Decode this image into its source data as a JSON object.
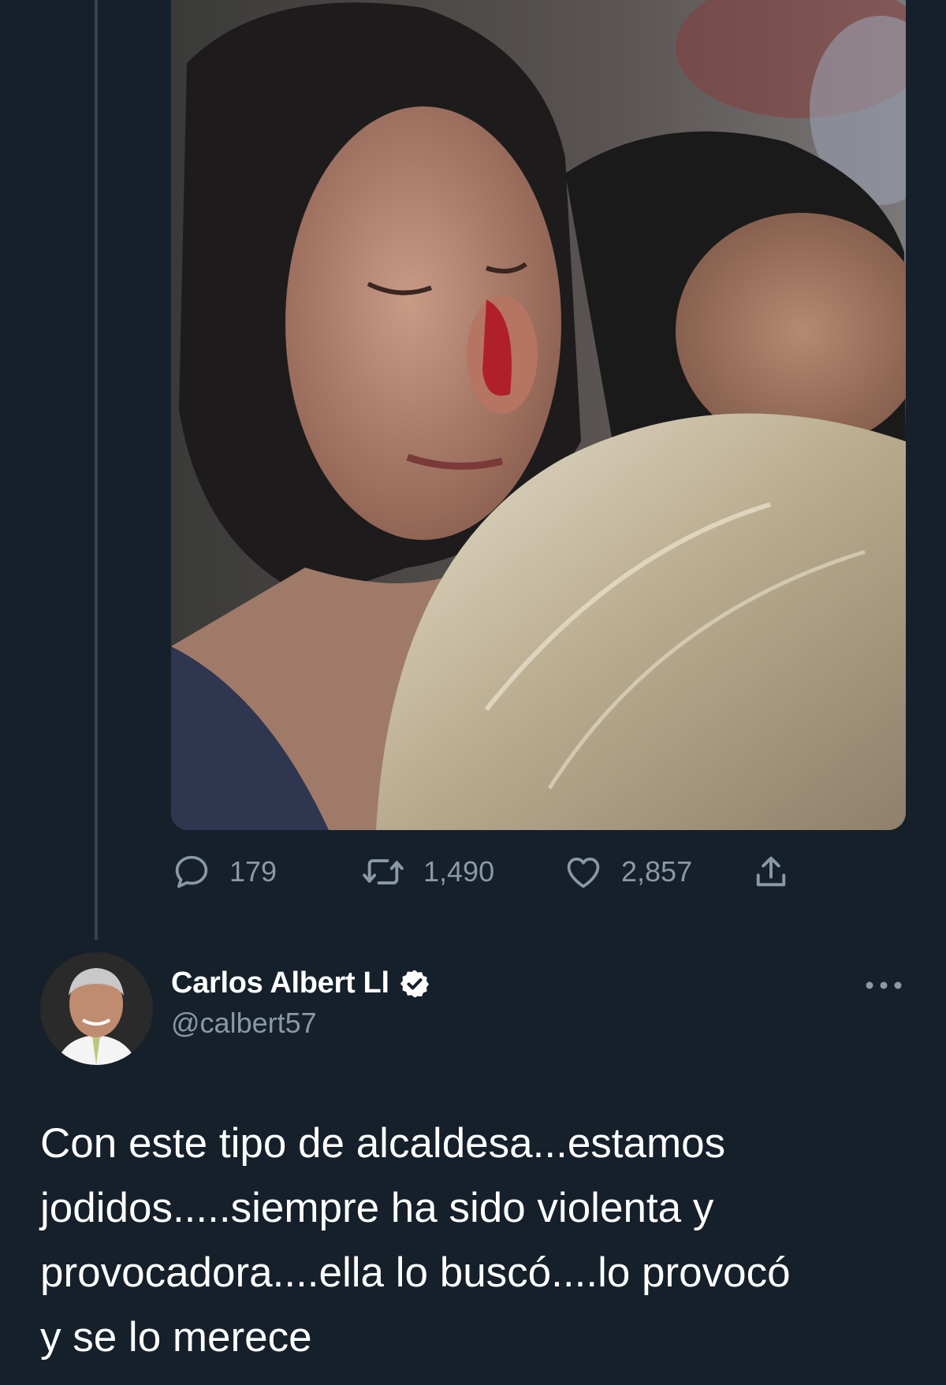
{
  "quoted_tweet": {
    "photo": {
      "icon": "photo-media"
    },
    "actions": {
      "replies": "179",
      "retweets": "1,490",
      "likes": "2,857"
    }
  },
  "tweet": {
    "author": {
      "display_name": "Carlos Albert Ll",
      "handle": "@calbert57",
      "verified": true
    },
    "text": "Con este tipo de alcaldesa...estamos\njodidos.....siempre ha sido violenta y\nprovocadora....ella lo buscó....lo provocó\ny se lo merece"
  },
  "colors": {
    "background": "#15202b",
    "thread_line": "#38444d",
    "secondary_text": "#8b98a5",
    "primary_text": "#ffffff"
  }
}
